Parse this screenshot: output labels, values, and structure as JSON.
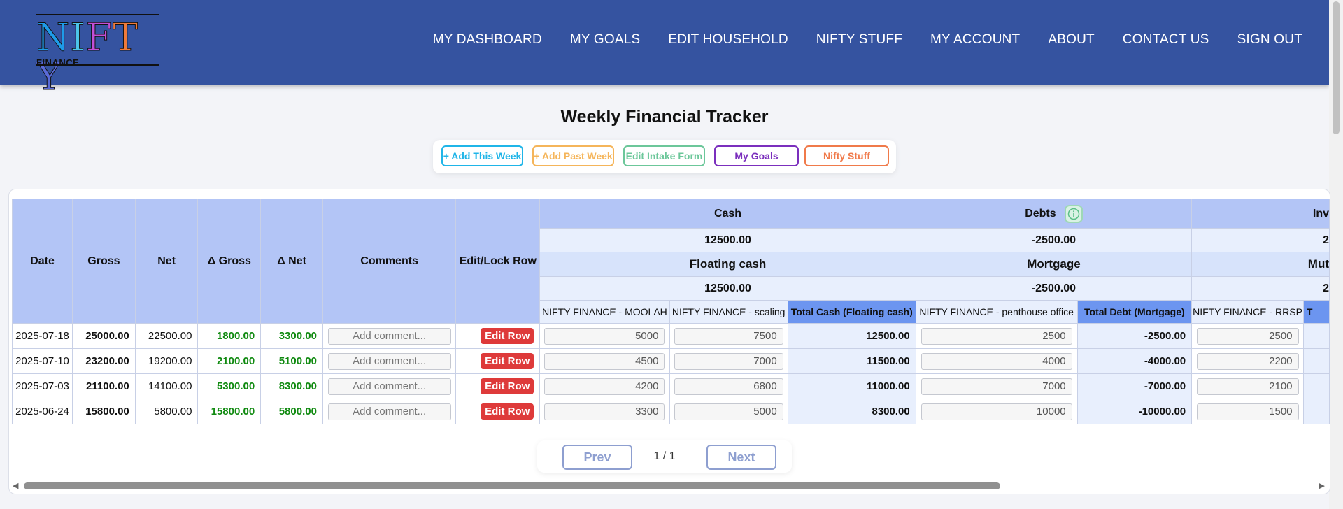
{
  "brand": {
    "logo_letters": [
      "N",
      "I",
      "F",
      "T",
      "Y"
    ],
    "logo_colors": [
      "#1e9be8",
      "#4cc6e8",
      "#c24fd6",
      "#f07a3a",
      "#5a6ad8"
    ],
    "sub": "FINANCE"
  },
  "nav": [
    "MY DASHBOARD",
    "MY GOALS",
    "EDIT HOUSEHOLD",
    "NIFTY STUFF",
    "MY ACCOUNT",
    "ABOUT",
    "CONTACT US",
    "SIGN OUT"
  ],
  "page_title": "Weekly Financial Tracker",
  "actions": [
    {
      "label": "+ Add This Week",
      "color": "#1fb5e8"
    },
    {
      "label": "+ Add Past Week",
      "color": "#f5b55a"
    },
    {
      "label": "Edit Intake Form",
      "color": "#6cc79a"
    },
    {
      "label": "My Goals",
      "color": "#7b2fbd"
    },
    {
      "label": "Nifty Stuff",
      "color": "#f07a4a"
    }
  ],
  "table": {
    "fixed_headers": [
      "Date",
      "Gross",
      "Net",
      "Δ Gross",
      "Δ Net",
      "Comments",
      "Edit/Lock Row"
    ],
    "groups": [
      {
        "name": "Cash",
        "total": "12500.00",
        "sub": "Floating cash",
        "sub_total": "12500.00",
        "cols": [
          "NIFTY FINANCE - MOOLAH",
          "NIFTY FINANCE - scaling",
          "Total Cash (Floating cash)"
        ]
      },
      {
        "name": "Debts",
        "total": "-2500.00",
        "sub": "Mortgage",
        "sub_total": "-2500.00",
        "cols": [
          "NIFTY FINANCE - penthouse office",
          "Total Debt (Mortgage)"
        ]
      },
      {
        "name": "Inv",
        "total": "2",
        "sub": "Mut",
        "sub_total": "2",
        "cols": [
          "NIFTY FINANCE - RRSP",
          "T"
        ]
      }
    ],
    "comment_placeholder": "Add comment...",
    "edit_label": "Edit Row",
    "rows": [
      {
        "date": "2025-07-18",
        "gross": "25000.00",
        "net": "22500.00",
        "dgross": "1800.00",
        "dnet": "3300.00",
        "moolah": "5000",
        "scaling": "7500",
        "total_cash": "12500.00",
        "penthouse": "2500",
        "total_debt": "-2500.00",
        "rrsp": "2500"
      },
      {
        "date": "2025-07-10",
        "gross": "23200.00",
        "net": "19200.00",
        "dgross": "2100.00",
        "dnet": "5100.00",
        "moolah": "4500",
        "scaling": "7000",
        "total_cash": "11500.00",
        "penthouse": "4000",
        "total_debt": "-4000.00",
        "rrsp": "2200"
      },
      {
        "date": "2025-07-03",
        "gross": "21100.00",
        "net": "14100.00",
        "dgross": "5300.00",
        "dnet": "8300.00",
        "moolah": "4200",
        "scaling": "6800",
        "total_cash": "11000.00",
        "penthouse": "7000",
        "total_debt": "-7000.00",
        "rrsp": "2100"
      },
      {
        "date": "2025-06-24",
        "gross": "15800.00",
        "net": "5800.00",
        "dgross": "15800.00",
        "dnet": "5800.00",
        "moolah": "3300",
        "scaling": "5000",
        "total_cash": "8300.00",
        "penthouse": "10000",
        "total_debt": "-10000.00",
        "rrsp": "1500"
      }
    ]
  },
  "pager": {
    "prev": "Prev",
    "next": "Next",
    "info": "1 / 1"
  }
}
